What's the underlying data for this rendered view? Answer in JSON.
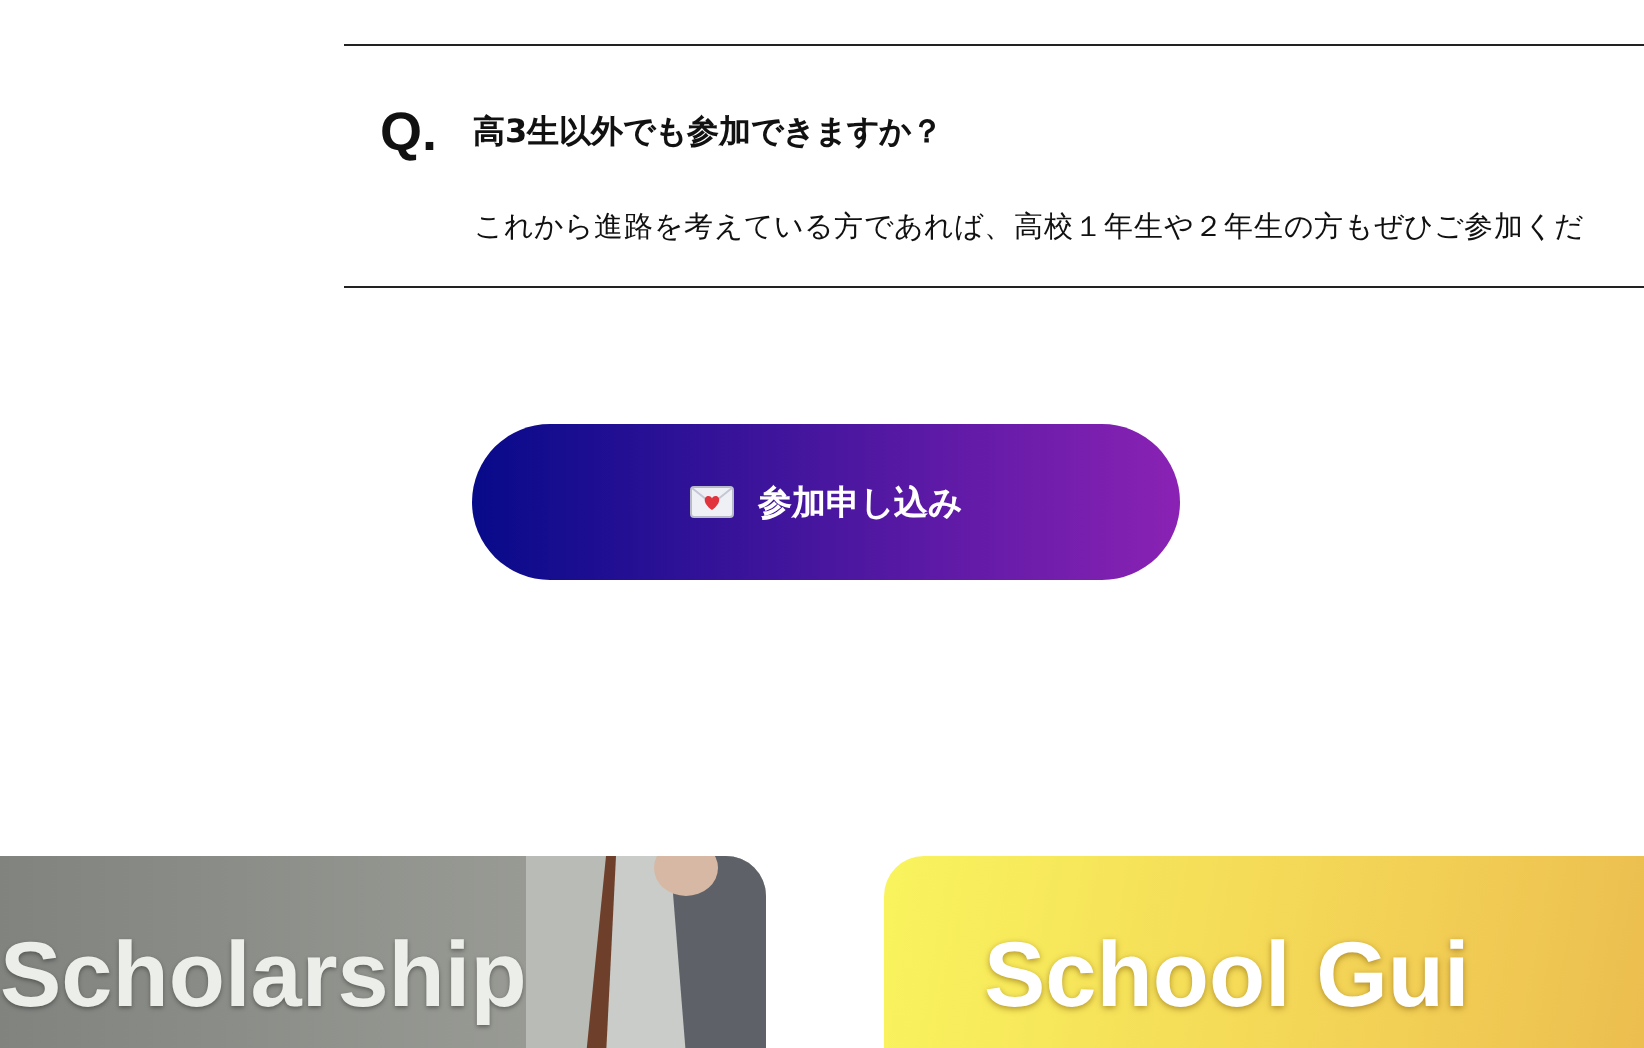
{
  "faq": {
    "q_mark": "Q.",
    "question": "高3生以外でも参加できますか？",
    "answer": "これから進路を考えている方であれば、高校１年生や２年生の方もぜひご参加くだ"
  },
  "apply_button": {
    "label": "参加申し込み"
  },
  "cards": [
    {
      "title": "Scholarship"
    },
    {
      "kind": "gradient",
      "title": "School Gui"
    }
  ]
}
